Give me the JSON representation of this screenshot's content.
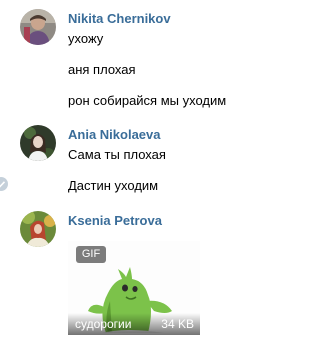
{
  "messages": [
    {
      "author": "Nikita Chernikov",
      "lines": [
        "ухожу",
        "аня плохая",
        "рон собирайся мы уходим"
      ]
    },
    {
      "author": "Ania Nikolaeva",
      "lines": [
        "Сама ты плохая",
        "Дастин уходим"
      ]
    },
    {
      "author": "Ksenia Petrova",
      "gif": {
        "badge": "GIF",
        "caption": "судорогии",
        "size": "34 KB"
      }
    }
  ],
  "colors": {
    "author_name": "#3a6d99",
    "background": "#ffffff",
    "gif_figure": "#7cc24a"
  }
}
